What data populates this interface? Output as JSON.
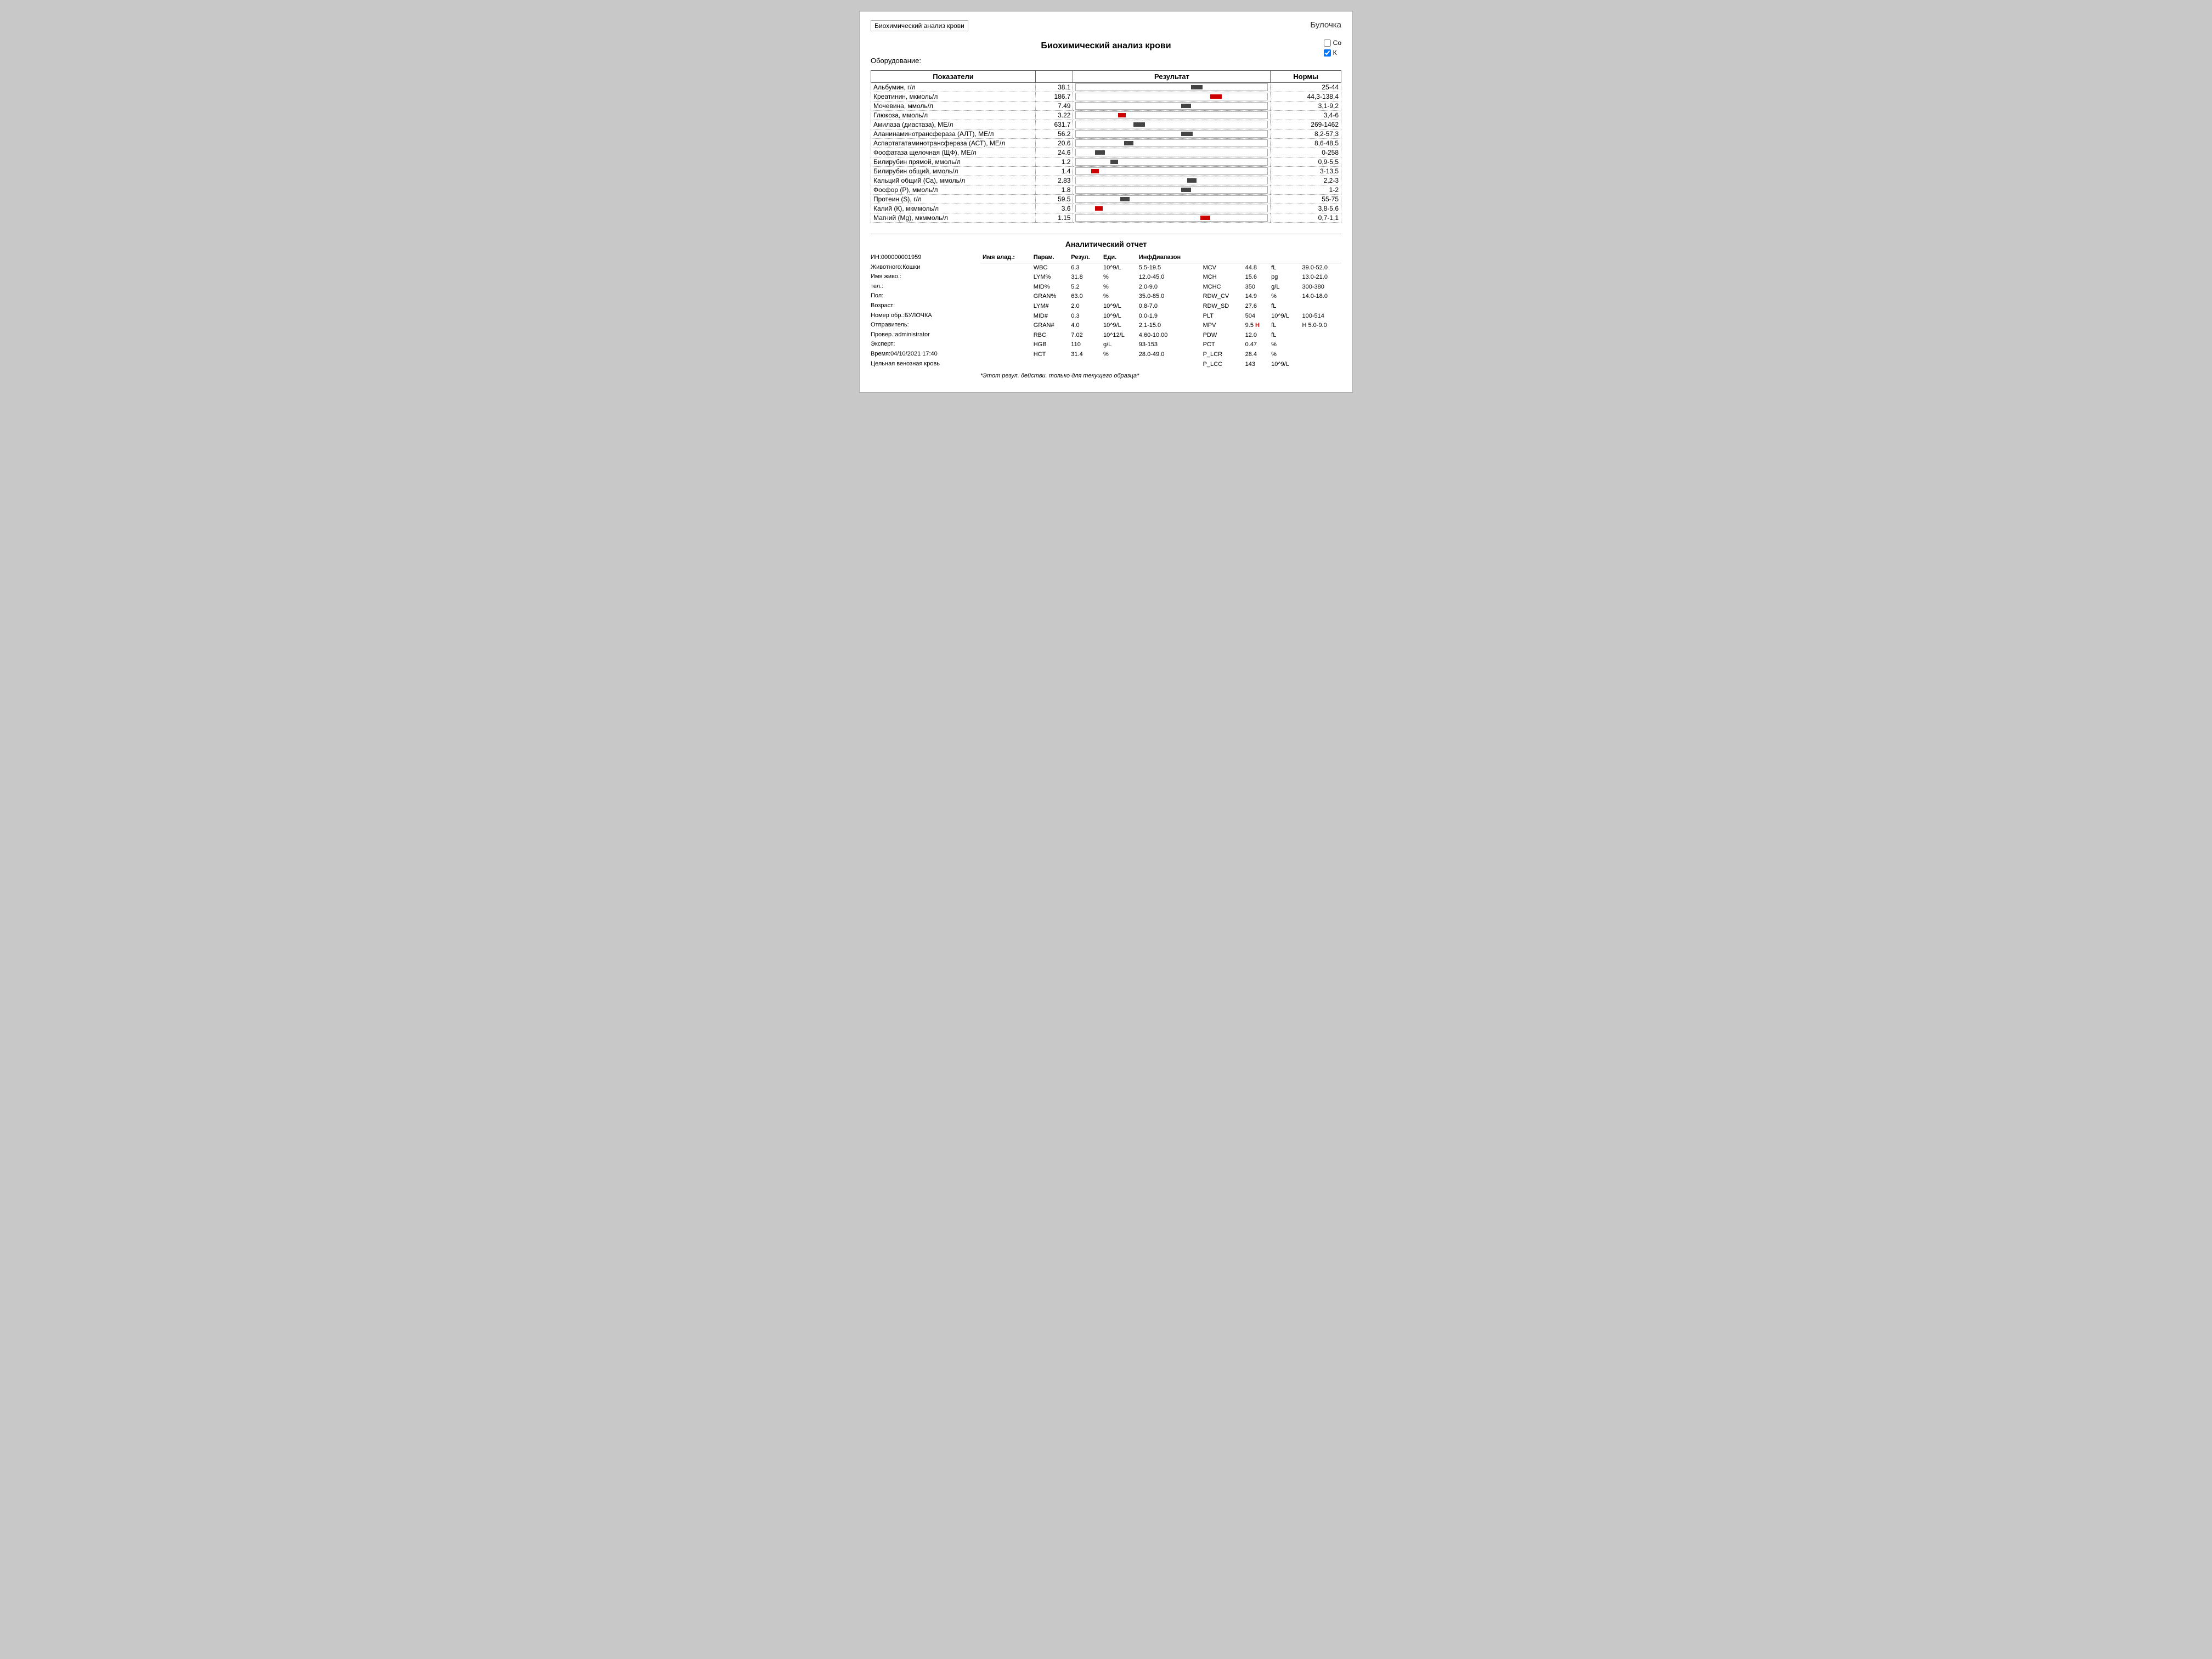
{
  "window": {
    "top_label": "Биохимический анализ крови",
    "title": "Биохимический анализ крови",
    "handwritten_name": "Булочка",
    "equipment": "Оборудование:"
  },
  "checkboxes": [
    {
      "label": "Co",
      "checked": false
    },
    {
      "label": "К",
      "checked": true
    }
  ],
  "table": {
    "headers": {
      "name": "Показатели",
      "result": "Результат",
      "norm": "Нормы"
    },
    "rows": [
      {
        "name": "Альбумин, г/л",
        "value": "38.1",
        "norm": "25-44",
        "pos": 60,
        "width": 6,
        "abnormal": false
      },
      {
        "name": "Креатинин, мкмоль/л",
        "value": "186.7",
        "norm": "44,3-138,4",
        "pos": 70,
        "width": 6,
        "abnormal": true
      },
      {
        "name": "Мочевина, ммоль/л",
        "value": "7.49",
        "norm": "3,1-9,2",
        "pos": 55,
        "width": 5,
        "abnormal": false
      },
      {
        "name": "Глюкоза, ммоль/л",
        "value": "3.22",
        "norm": "3,4-6",
        "pos": 22,
        "width": 4,
        "abnormal": true
      },
      {
        "name": "Амилаза (диастаза), МЕ/л",
        "value": "631.7",
        "norm": "269-1462",
        "pos": 30,
        "width": 6,
        "abnormal": false
      },
      {
        "name": "Аланинаминотрансфераза (АЛТ), МЕ/л",
        "value": "56.2",
        "norm": "8,2-57,3",
        "pos": 55,
        "width": 6,
        "abnormal": false
      },
      {
        "name": "Аспартататаминотрансфераза (АСТ), МЕ/л",
        "value": "20.6",
        "norm": "8,6-48,5",
        "pos": 25,
        "width": 5,
        "abnormal": false
      },
      {
        "name": "Фосфатаза щелочная (ЩФ), МЕ/л",
        "value": "24.6",
        "norm": "0-258",
        "pos": 10,
        "width": 5,
        "abnormal": false
      },
      {
        "name": "Билирубин прямой, ммоль/л",
        "value": "1.2",
        "norm": "0,9-5,5",
        "pos": 18,
        "width": 4,
        "abnormal": false
      },
      {
        "name": "Билирубин общий, ммоль/л",
        "value": "1.4",
        "norm": "3-13,5",
        "pos": 8,
        "width": 4,
        "abnormal": true
      },
      {
        "name": "Кальций общий (Ca), ммоль/л",
        "value": "2.83",
        "norm": "2,2-3",
        "pos": 58,
        "width": 5,
        "abnormal": false
      },
      {
        "name": "Фосфор (Р), ммоль/л",
        "value": "1.8",
        "norm": "1-2",
        "pos": 55,
        "width": 5,
        "abnormal": false
      },
      {
        "name": "Протеин (S), г/л",
        "value": "59.5",
        "norm": "55-75",
        "pos": 23,
        "width": 5,
        "abnormal": false
      },
      {
        "name": "Калий (К), мкммоль/л",
        "value": "3.6",
        "norm": "3,8-5,6",
        "pos": 10,
        "width": 4,
        "abnormal": true
      },
      {
        "name": "Магний (Mg), мкммоль/л",
        "value": "1.15",
        "norm": "0,7-1,1",
        "pos": 65,
        "width": 5,
        "abnormal": true
      }
    ]
  },
  "analytics": {
    "title": "Аналитический отчет",
    "info_rows": [
      {
        "label": "ИН:000000001959",
        "value": ""
      },
      {
        "label": "Животного:Кошки",
        "value": ""
      },
      {
        "label": "Имя живо.:",
        "value": ""
      },
      {
        "label": "тел.:",
        "value": ""
      },
      {
        "label": "Пол:",
        "value": ""
      },
      {
        "label": "Возраст:",
        "value": ""
      },
      {
        "label": "Номер обр.:БУЛОЧКА",
        "value": ""
      },
      {
        "label": "Отправитель:",
        "value": ""
      },
      {
        "label": "Провер.:administrator",
        "value": ""
      },
      {
        "label": "Эксперт:",
        "value": ""
      },
      {
        "label": "Время:04/10/2021 17:40",
        "value": ""
      },
      {
        "label": "Цельная венозная кровь",
        "value": ""
      }
    ],
    "params_header_left": {
      "imya_vlad": "Имя влад.:",
      "param": "Парам.",
      "rezul": "Резул.",
      "edi": "Еди.",
      "inf_diapazon": "ИнфДиапазон"
    },
    "params_header_right": {
      "param": "MCV",
      "col1": "",
      "col2": "fL",
      "col3": "39.0-52.0"
    },
    "params_rows": [
      {
        "param": "WBC",
        "value": "6.3",
        "unit": "10^9/L",
        "range": "5.5-19.5",
        "rparam": "MCV",
        "rvalue": "44.8",
        "runit": "fL",
        "rrange": "39.0-52.0",
        "rflag": ""
      },
      {
        "param": "LYM%",
        "value": "31.8",
        "unit": "%",
        "range": "12.0-45.0",
        "rparam": "MCH",
        "rvalue": "15.6",
        "runit": "pg",
        "rrange": "13.0-21.0",
        "rflag": ""
      },
      {
        "param": "MID%",
        "value": "5.2",
        "unit": "%",
        "range": "2.0-9.0",
        "rparam": "MCHC",
        "rvalue": "350",
        "runit": "g/L",
        "rrange": "300-380",
        "rflag": ""
      },
      {
        "param": "GRAN%",
        "value": "63.0",
        "unit": "%",
        "range": "35.0-85.0",
        "rparam": "RDW_CV",
        "rvalue": "14.9",
        "runit": "%",
        "rrange": "14.0-18.0",
        "rflag": ""
      },
      {
        "param": "LYM#",
        "value": "2.0",
        "unit": "10^9/L",
        "range": "0.8-7.0",
        "rparam": "RDW_SD",
        "rvalue": "27.6",
        "runit": "fL",
        "rrange": "",
        "rflag": ""
      },
      {
        "param": "MID#",
        "value": "0.3",
        "unit": "10^9/L",
        "range": "0.0-1.9",
        "rparam": "PLT",
        "rvalue": "504",
        "runit": "10^9/L",
        "rrange": "100-514",
        "rflag": ""
      },
      {
        "param": "GRAN#",
        "value": "4.0",
        "unit": "10^9/L",
        "range": "2.1-15.0",
        "rparam": "MPV",
        "rvalue": "9.5",
        "runit": "fL",
        "rrange": "H 5.0-9.0",
        "rflag": "H"
      },
      {
        "param": "RBC",
        "value": "7.02",
        "unit": "10^12/L",
        "range": "4.60-10.00",
        "rparam": "PDW",
        "rvalue": "12.0",
        "runit": "fL",
        "rrange": "",
        "rflag": ""
      },
      {
        "param": "HGB",
        "value": "110",
        "unit": "g/L",
        "range": "93-153",
        "rparam": "PCT",
        "rvalue": "0.47",
        "runit": "%",
        "rrange": "",
        "rflag": ""
      },
      {
        "param": "HCT",
        "value": "31.4",
        "unit": "%",
        "range": "28.0-49.0",
        "rparam": "P_LCR",
        "rvalue": "28.4",
        "runit": "%",
        "rrange": "",
        "rflag": ""
      },
      {
        "param": "",
        "value": "",
        "unit": "",
        "range": "",
        "rparam": "P_LCC",
        "rvalue": "143",
        "runit": "10^9/L",
        "rrange": "",
        "rflag": ""
      }
    ],
    "footer_note": "*Этот резул. действи. только для текущего образца*"
  }
}
